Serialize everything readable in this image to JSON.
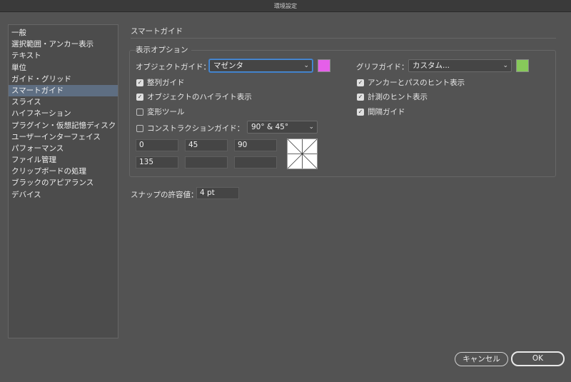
{
  "window": {
    "title": "環境設定"
  },
  "sidebar": {
    "items": [
      "一般",
      "選択範囲・アンカー表示",
      "テキスト",
      "単位",
      "ガイド・グリッド",
      "スマートガイド",
      "スライス",
      "ハイフネーション",
      "プラグイン・仮想記憶ディスク",
      "ユーザーインターフェイス",
      "パフォーマンス",
      "ファイル管理",
      "クリップボードの処理",
      "ブラックのアピアランス",
      "デバイス"
    ],
    "selected_index": 5
  },
  "section": {
    "title": "スマートガイド",
    "display_options_label": "表示オプション",
    "object_guide_label": "オブジェクトガイド：",
    "object_guide_value": "マゼンタ",
    "object_guide_color": "#e55fe9",
    "glyph_guide_label": "グリフガイド：",
    "glyph_guide_value": "カスタム...",
    "glyph_guide_color": "#87c95a",
    "alignment_guides": {
      "label": "整列ガイド",
      "checked": true
    },
    "object_highlight": {
      "label": "オブジェクトのハイライト表示",
      "checked": true
    },
    "transform_tools": {
      "label": "変形ツール",
      "checked": false
    },
    "construction_guides": {
      "label": "コンストラクションガイド：",
      "checked": false
    },
    "construction_angles_value": "90° & 45°",
    "anchor_path_hints": {
      "label": "アンカーとパスのヒント表示",
      "checked": true
    },
    "measurement_hints": {
      "label": "計測のヒント表示",
      "checked": true
    },
    "spacing_guides": {
      "label": "間隔ガイド",
      "checked": true
    },
    "angles": [
      "0",
      "45",
      "90",
      "135",
      "",
      ""
    ],
    "snap_tolerance_label": "スナップの許容値：",
    "snap_tolerance_value": "4 pt"
  },
  "buttons": {
    "cancel": "キャンセル",
    "ok": "OK"
  }
}
